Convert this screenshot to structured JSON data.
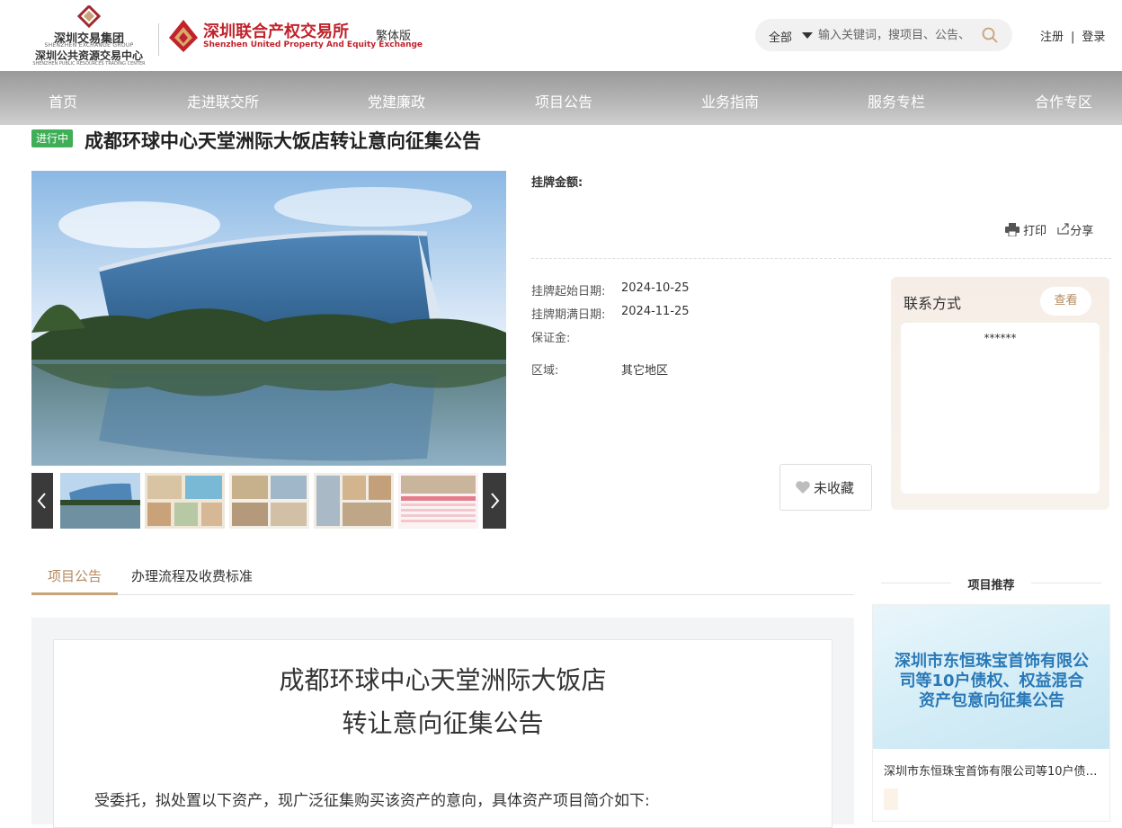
{
  "header": {
    "logo_group": {
      "line1": "深圳交易集团",
      "line2": "SHENZHEN EXCHANGE GROUP",
      "line3": "深圳公共资源交易中心",
      "line4": "SHENZHEN PUBLIC RESOURCES TRADING CENTER"
    },
    "logo_exchange": {
      "cn": "深圳联合产权交易所",
      "en": "Shenzhen United Property And Equity Exchange"
    },
    "traditional_label": "繁体版",
    "search": {
      "scope": "全部",
      "placeholder": "输入关键词，搜项目、公告、"
    },
    "register_label": "注册",
    "divider": "|",
    "login_label": "登录"
  },
  "nav": [
    "首页",
    "走进联交所",
    "党建廉政",
    "项目公告",
    "业务指南",
    "服务专栏",
    "合作专区"
  ],
  "project": {
    "status": "进行中",
    "title": "成都环球中心天堂洲际大饭店转让意向征集公告",
    "price_label": "挂牌金额:",
    "print_label": "打印",
    "share_label": "分享",
    "start_date_label": "挂牌起始日期:",
    "start_date": "2024-10-25",
    "end_date_label": "挂牌期满日期:",
    "end_date": "2024-11-25",
    "deposit_label": "保证金:",
    "region_label": "区域:",
    "region": "其它地区",
    "favorite_label": "未收藏"
  },
  "contact": {
    "title": "联系方式",
    "view_label": "查看",
    "masked": "******"
  },
  "tabs": [
    "项目公告",
    "办理流程及收费标准"
  ],
  "document": {
    "title_line1": "成都环球中心天堂洲际大饭店",
    "title_line2": "转让意向征集公告",
    "intro": "受委托，拟处置以下资产，现广泛征集购买该资产的意向，具体资产项目简介如下:"
  },
  "recommend": {
    "heading": "项目推荐",
    "image_text": "深圳市东恒珠宝首饰有限公司等10户债权、权益混合资产包意向征集公告",
    "name": "深圳市东恒珠宝首饰有限公司等10户债权、权益混合资产包意向征集公告"
  },
  "colors": {
    "accent": "#b48a5e",
    "brand_red": "#c0232c",
    "status_green": "#3fae57"
  }
}
